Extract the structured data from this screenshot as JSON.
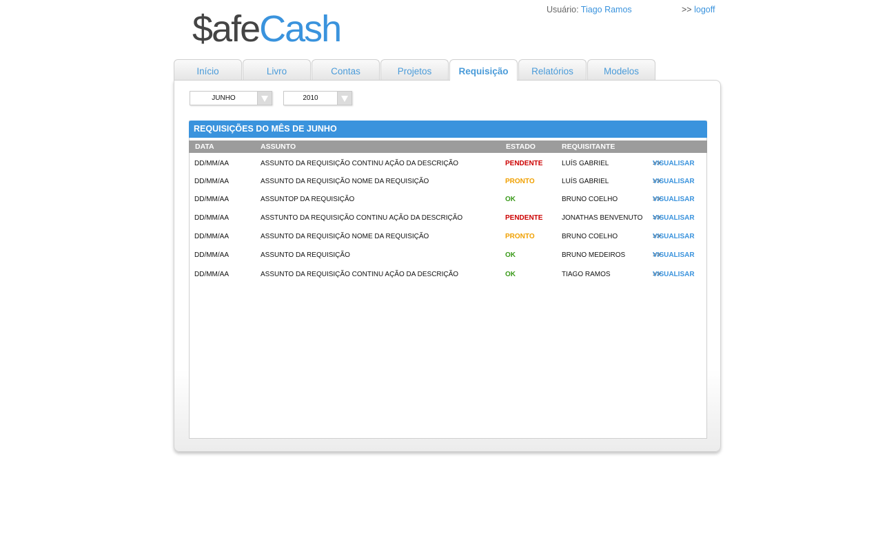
{
  "logo": {
    "part1": "$afe",
    "part2": "Cash"
  },
  "header": {
    "user_label": "Usuário:",
    "user_name": "Tiago Ramos",
    "logoff_prefix": ">>",
    "logoff_label": "logoff"
  },
  "tabs": [
    {
      "label": "Início"
    },
    {
      "label": "Livro"
    },
    {
      "label": "Contas"
    },
    {
      "label": "Projetos"
    },
    {
      "label": "Requisição",
      "active": true
    },
    {
      "label": "Relatórios"
    },
    {
      "label": "Modelos"
    }
  ],
  "filters": {
    "month": "JUNHO",
    "year": "2010"
  },
  "section": {
    "title": "REQUISIÇÕES DO MÊS DE JUNHO"
  },
  "table": {
    "headers": {
      "date": "DATA",
      "subject": "ASSUNTO",
      "status": "ESTADO",
      "requester": "REQUISITANTE"
    },
    "rows": [
      {
        "date": "DD/MM/AA",
        "subject": "ASSUNTO DA REQUISIÇÃO CONTINU AÇÃO DA DESCRIÇÃO",
        "status": "PENDENTE",
        "status_color": "#cc0000",
        "requester": "LUÍS GABRIEL",
        "action_prefix": ">>",
        "action": "VISUALISAR"
      },
      {
        "date": "DD/MM/AA",
        "subject": "ASSUNTO DA REQUISIÇÃO NOME DA REQUISIÇÃO",
        "status": "PRONTO",
        "status_color": "#f0a000",
        "requester": "LUÍS GABRIEL",
        "action_prefix": ">>",
        "action": "VISUALISAR"
      },
      {
        "date": "DD/MM/AA",
        "subject": "ASSUNTOP  DA REQUISIÇÃO",
        "status": "OK",
        "status_color": "#3a9a1a",
        "requester": "BRUNO COELHO",
        "action_prefix": ">>",
        "action": "VISUALISAR"
      },
      {
        "date": "DD/MM/AA",
        "subject": "ASSTUNTO  DA REQUISIÇÃO CONTINU AÇÃO DA DESCRIÇÃO",
        "status": "PENDENTE",
        "status_color": "#cc0000",
        "requester": "JONATHAS BENVENUTO",
        "action_prefix": ">>",
        "action": "VISUALISAR"
      },
      {
        "date": "DD/MM/AA",
        "subject": "ASSUNTO  DA REQUISIÇÃO NOME DA REQUISIÇÃO",
        "status": "PRONTO",
        "status_color": "#f0a000",
        "requester": "BRUNO COELHO",
        "action_prefix": ">>",
        "action": "VISUALISAR"
      },
      {
        "date": "DD/MM/AA",
        "subject": "ASSUNTO  DA REQUISIÇÃO",
        "status": "OK",
        "status_color": "#3a9a1a",
        "requester": "BRUNO MEDEIROS",
        "action_prefix": ">>",
        "action": "VISUALISAR"
      },
      {
        "date": "DD/MM/AA",
        "subject": "ASSUNTO DA REQUISIÇÃO CONTINU AÇÃO DA DESCRIÇÃO",
        "status": "OK",
        "status_color": "#3a9a1a",
        "requester": "TIAGO RAMOS",
        "action_prefix": ">>",
        "action": "VISUALISAR"
      }
    ]
  }
}
